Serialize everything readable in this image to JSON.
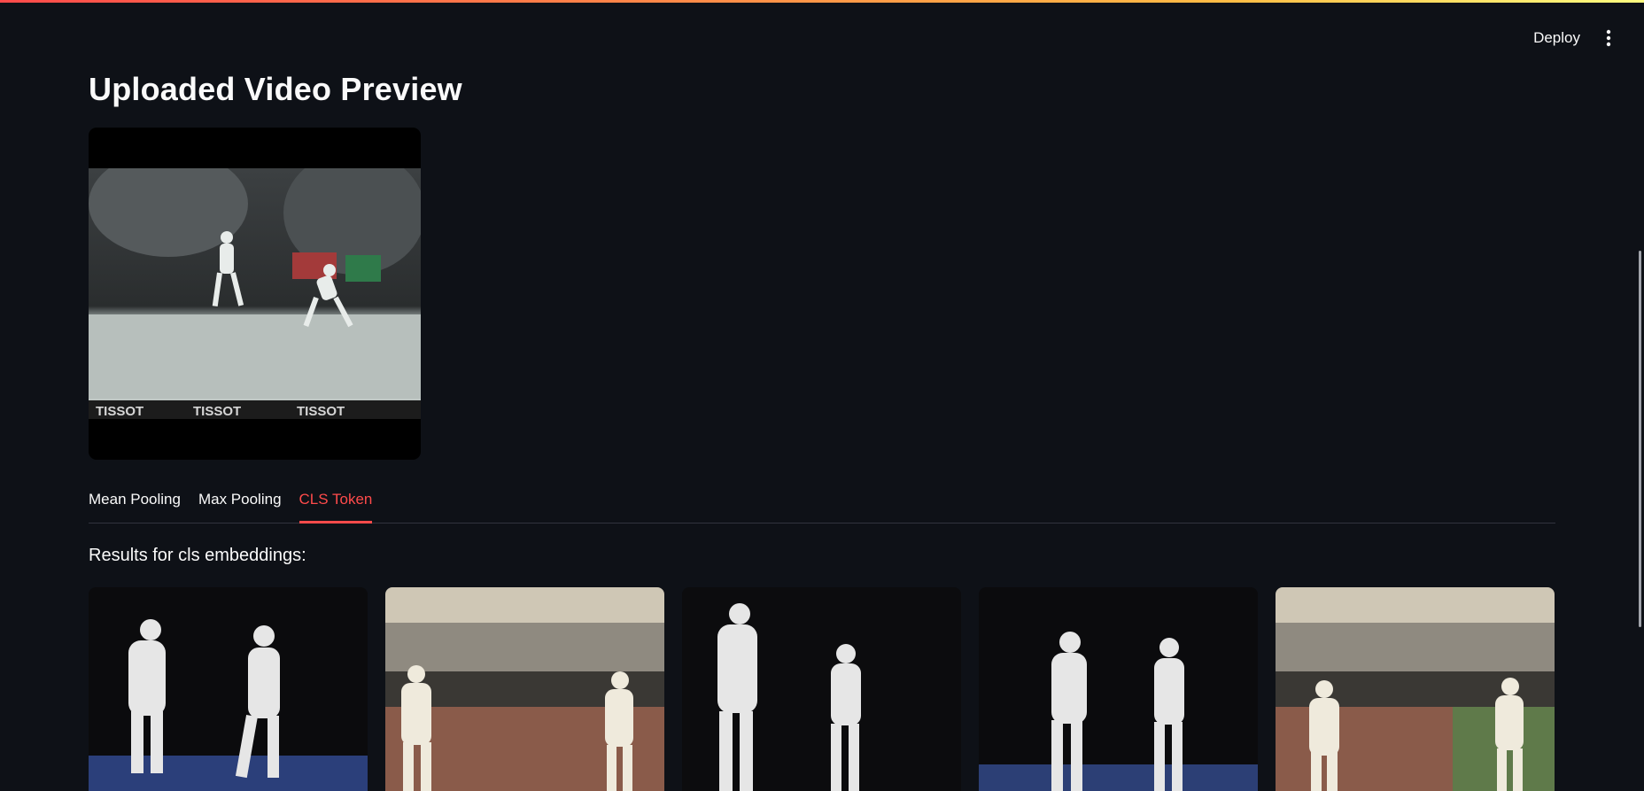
{
  "header": {
    "deploy_label": "Deploy",
    "menu_icon": "more-vertical-icon"
  },
  "page": {
    "title": "Uploaded Video Preview"
  },
  "video": {
    "description_icon": "video-player",
    "brand_text": "TISSOT"
  },
  "tabs": [
    {
      "label": "Mean Pooling",
      "active": false
    },
    {
      "label": "Max Pooling",
      "active": false
    },
    {
      "label": "CLS Token",
      "active": true
    }
  ],
  "results": {
    "label": "Results for cls embeddings:",
    "thumbnails": [
      {
        "scene": "dark"
      },
      {
        "scene": "hall"
      },
      {
        "scene": "dark"
      },
      {
        "scene": "dark"
      },
      {
        "scene": "hall"
      }
    ]
  },
  "colors": {
    "background": "#0e1117",
    "accent": "#ff4b4b",
    "text": "#fafafa"
  }
}
